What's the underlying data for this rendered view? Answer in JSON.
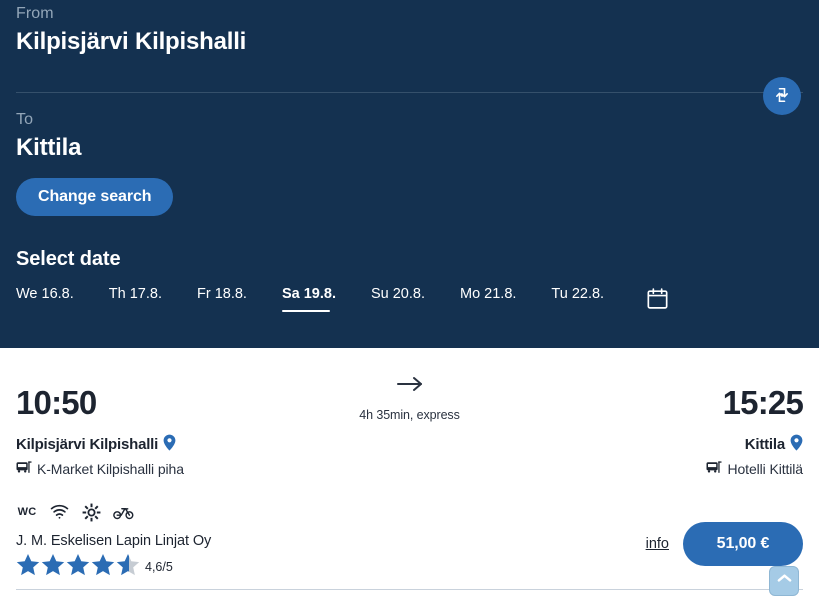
{
  "search": {
    "from_label": "From",
    "from_value": "Kilpisjärvi Kilpishalli",
    "to_label": "To",
    "to_value": "Kittila",
    "swap_icon": "swap-arrows-icon",
    "change_search_label": "Change search"
  },
  "date_picker": {
    "title": "Select date",
    "calendar_icon": "calendar-icon",
    "dates": [
      {
        "label": "We 16.8.",
        "selected": false
      },
      {
        "label": "Th 17.8.",
        "selected": false
      },
      {
        "label": "Fr 18.8.",
        "selected": false
      },
      {
        "label": "Sa 19.8.",
        "selected": true
      },
      {
        "label": "Su 20.8.",
        "selected": false
      },
      {
        "label": "Mo 21.8.",
        "selected": false
      },
      {
        "label": "Tu 22.8.",
        "selected": false
      }
    ]
  },
  "trip": {
    "departure_time": "10:50",
    "arrival_time": "15:25",
    "duration": "4h 35min, express",
    "arrow_icon": "arrow-right-icon",
    "origin": {
      "name": "Kilpisjärvi Kilpishalli",
      "pin_icon": "map-pin-icon",
      "stop_icon": "bus-stop-icon",
      "stop_detail": "K-Market Kilpishalli piha"
    },
    "destination": {
      "name": "Kittila",
      "pin_icon": "map-pin-icon",
      "stop_icon": "bus-stop-icon",
      "stop_detail": "Hotelli Kittilä"
    },
    "amenities": [
      {
        "name": "wc-icon",
        "label": "WC"
      },
      {
        "name": "wifi-icon",
        "label": "Wi-Fi"
      },
      {
        "name": "air-conditioning-icon",
        "label": "Air conditioning"
      },
      {
        "name": "bicycle-icon",
        "label": "Bicycle"
      }
    ],
    "operator": "J. M. Eskelisen Lapin Linjat Oy",
    "rating_value": "4,6/5",
    "rating_stars": 4.6,
    "rating_max": 5,
    "info_label": "info",
    "price_label": "51,00 €"
  },
  "scroll_top": {
    "icon": "chevron-up-icon"
  },
  "colors": {
    "header_bg": "#143150",
    "accent_blue": "#2b6cb4",
    "star_blue": "#2b6cb4",
    "pin_blue": "#2b6cb4",
    "text_dark": "#1d2430",
    "muted_label": "#93a6b8",
    "scroll_top_bg": "#a5cbe6"
  }
}
